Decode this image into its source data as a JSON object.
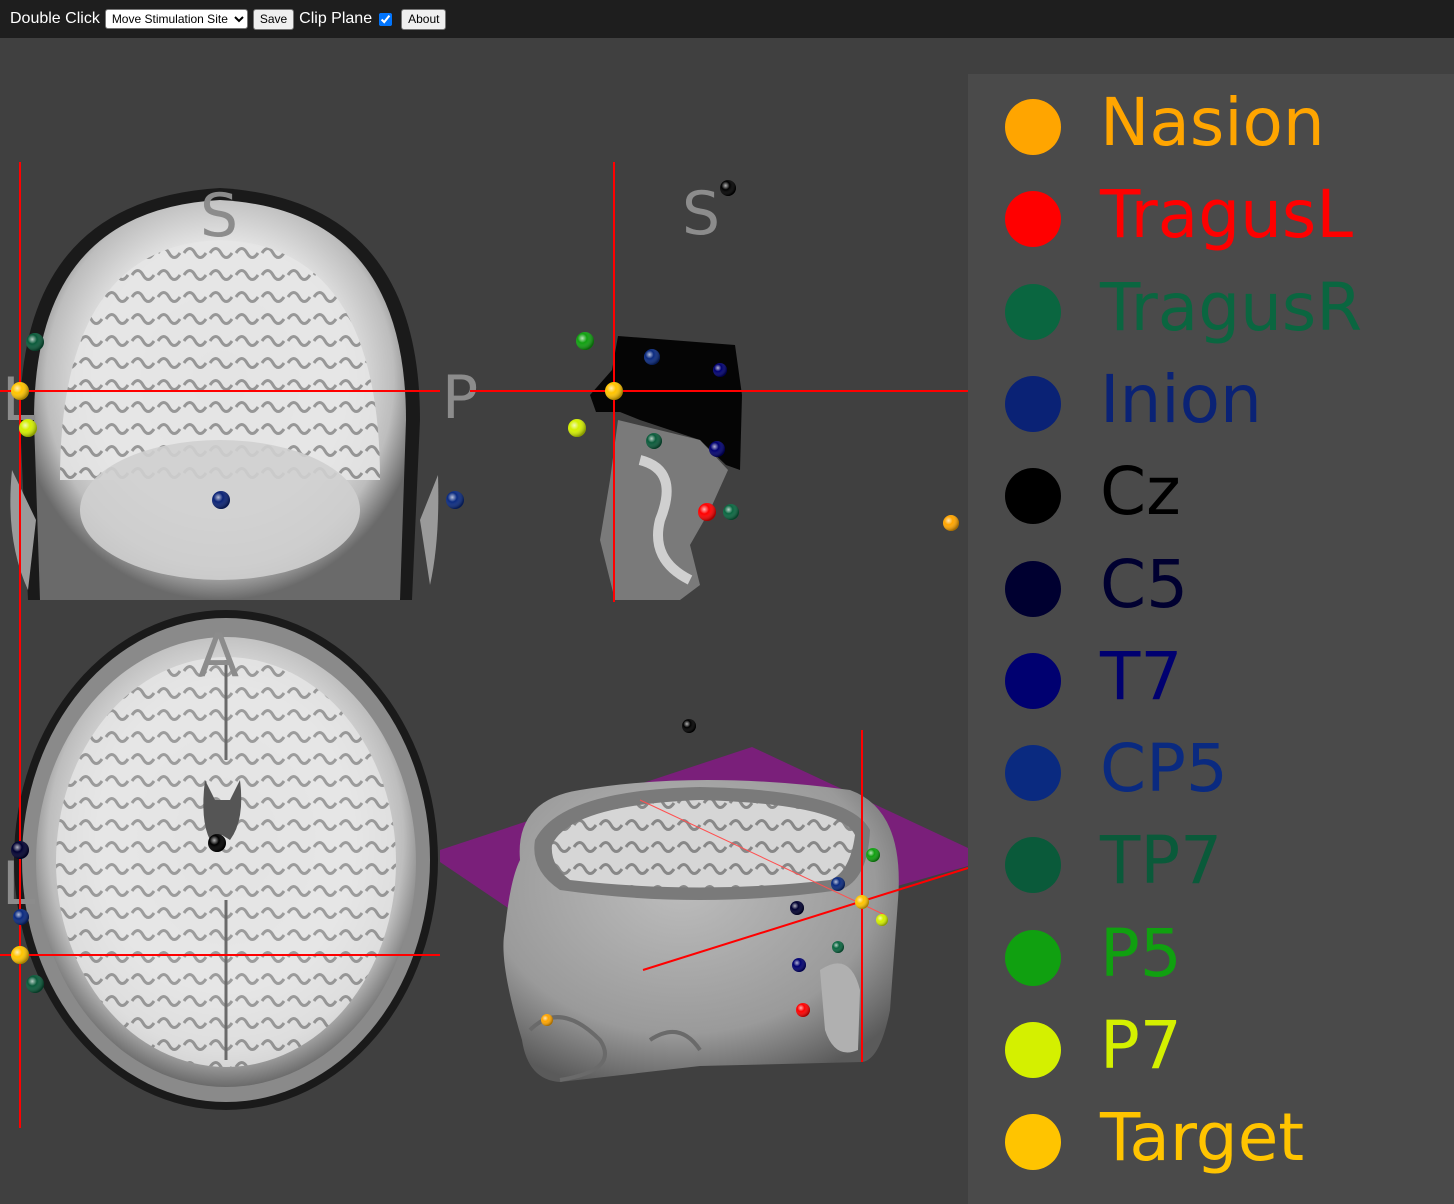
{
  "toolbar": {
    "double_click_label": "Double Click",
    "double_click_select": {
      "selected": "Move Stimulation Site",
      "options": [
        "Move Stimulation Site"
      ]
    },
    "save_label": "Save",
    "clip_plane_label": "Clip Plane",
    "clip_plane_checked": true,
    "about_label": "About"
  },
  "views": {
    "coronal": {
      "top_label": "S",
      "left_label": "L",
      "right_label": "P"
    },
    "sagittal": {
      "top_label": "S"
    },
    "axial": {
      "top_label": "A",
      "left_label": "L"
    }
  },
  "legend": [
    {
      "label": "Nasion",
      "color": "#ffa500"
    },
    {
      "label": "TragusL",
      "color": "#ff0000"
    },
    {
      "label": "TragusR",
      "color": "#0a6640"
    },
    {
      "label": "Inion",
      "color": "#0a2275"
    },
    {
      "label": "Cz",
      "color": "#000000"
    },
    {
      "label": "C5",
      "color": "#000030"
    },
    {
      "label": "T7",
      "color": "#000070"
    },
    {
      "label": "CP5",
      "color": "#0a2a80"
    },
    {
      "label": "TP7",
      "color": "#0a5a3a"
    },
    {
      "label": "P5",
      "color": "#10a010"
    },
    {
      "label": "P7",
      "color": "#d4f000"
    },
    {
      "label": "Target",
      "color": "#ffc400"
    }
  ],
  "colors": {
    "crosshair": "#ff0000",
    "clip_plane": "#7a1f7a",
    "background": "#404040",
    "toolbar": "#1e1e1e",
    "legend_panel": "#4a4a4a"
  }
}
